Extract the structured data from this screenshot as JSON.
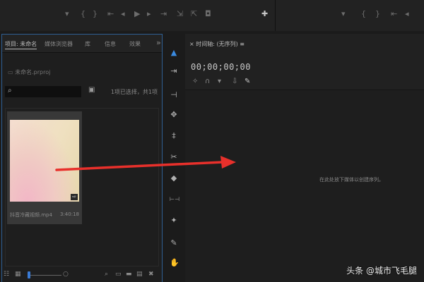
{
  "top_toolbar": {
    "source_icons": [
      "marker-icon",
      "in-point-icon",
      "out-point-icon",
      "goto-in-icon",
      "step-back-icon",
      "play-icon",
      "step-forward-icon",
      "goto-out-icon",
      "insert-icon",
      "overwrite-icon",
      "export-frame-icon",
      "add-button-icon"
    ],
    "program_icons": [
      "marker-icon",
      "in-point-icon",
      "out-point-icon"
    ]
  },
  "project_panel": {
    "tabs": [
      {
        "label": "项目: 未命名",
        "active": true
      },
      {
        "label": "媒体浏览器",
        "active": false
      },
      {
        "label": "库",
        "active": false
      },
      {
        "label": "信息",
        "active": false
      },
      {
        "label": "效果",
        "active": false
      }
    ],
    "more_glyph": "»",
    "project_file": "未命名.prproj",
    "search": {
      "value": "",
      "placeholder": ""
    },
    "selection_status": "1项已选择，共1项",
    "clip": {
      "name": "抖音冷藏视频.mp4",
      "duration": "3:40:18"
    }
  },
  "tools": [
    {
      "name": "selection-tool",
      "glyph": "▲",
      "active": true
    },
    {
      "name": "track-select-tool",
      "glyph": "⇥",
      "active": false
    },
    {
      "name": "ripple-edit-tool",
      "glyph": "⊣",
      "active": false
    },
    {
      "name": "rolling-edit-tool",
      "glyph": "✥",
      "active": false
    },
    {
      "name": "rate-stretch-tool",
      "glyph": "‡",
      "active": false
    },
    {
      "name": "razor-tool",
      "glyph": "✂",
      "active": false
    },
    {
      "name": "slip-tool",
      "glyph": "◆",
      "active": false
    },
    {
      "name": "slide-tool",
      "glyph": "⊢⊣",
      "active": false
    },
    {
      "name": "pen-tool",
      "glyph": "✦",
      "active": false
    },
    {
      "name": "hand-tool",
      "glyph": "✎",
      "active": false
    },
    {
      "name": "zoom-tool",
      "glyph": "✋",
      "active": false
    }
  ],
  "timeline": {
    "tab_label": "时间轴: (无序列)",
    "timecode": "00;00;00;00",
    "drop_hint": "在此处放下媒体以创建序列。"
  },
  "watermark": "头条 @城市飞毛腿",
  "arrow_color": "#e8302b",
  "accent_color": "#3a8ae0"
}
